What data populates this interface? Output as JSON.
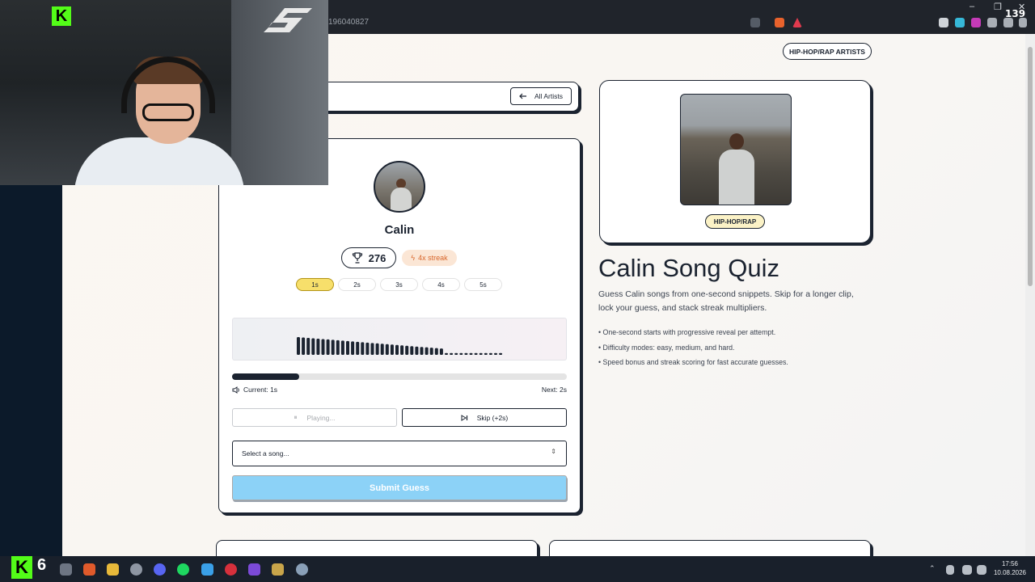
{
  "browser": {
    "address_text": "196040827",
    "tab_count": "139",
    "minimize": "–",
    "restore": "❐",
    "close": "✕"
  },
  "header": {
    "category_badge": "HIP-HOP/RAP ARTISTS"
  },
  "nav": {
    "back_label": "All Artists"
  },
  "quiz": {
    "artist_name": "Calin",
    "score": "276",
    "streak": "4x streak",
    "snippets": [
      "1s",
      "2s",
      "3s",
      "4s",
      "5s"
    ],
    "active_snippet_index": 0,
    "progress_fraction": 0.2,
    "current_label": "Current: 1s",
    "next_label": "Next: 2s",
    "play_label": "Playing...",
    "skip_label": "Skip (+2s)",
    "select_placeholder": "Select a song...",
    "submit_label": "Submit Guess"
  },
  "info": {
    "genre_badge": "HIP-HOP/RAP",
    "title": "Calin Song Quiz",
    "description": "Guess Calin songs from one-second snippets. Skip for a longer clip, lock your guess, and stack streak multipliers.",
    "bullets": [
      "• One-second starts with progressive reveal per attempt.",
      "• Difficulty modes: easy, medium, and hard.",
      "• Speed bonus and streak scoring for fast accurate guesses."
    ]
  },
  "overlay": {
    "kick_letter": "K",
    "kick_badge_number": "6"
  },
  "taskbar": {
    "time": "17:56",
    "date": "10.08.2026"
  },
  "colors": {
    "active_snippet": "#f7df6b",
    "submit_button": "#8cd2f7",
    "streak_badge": "#fbe6d5",
    "accent_dark": "#1b2330",
    "kick_green": "#53fc18"
  },
  "icons": {
    "back": "arrow-left-icon",
    "trophy": "trophy-icon",
    "streak": "bolt-icon",
    "volume": "speaker-icon",
    "pause": "pause-icon",
    "skip": "skip-next-icon",
    "select": "chevron-updown-icon"
  }
}
